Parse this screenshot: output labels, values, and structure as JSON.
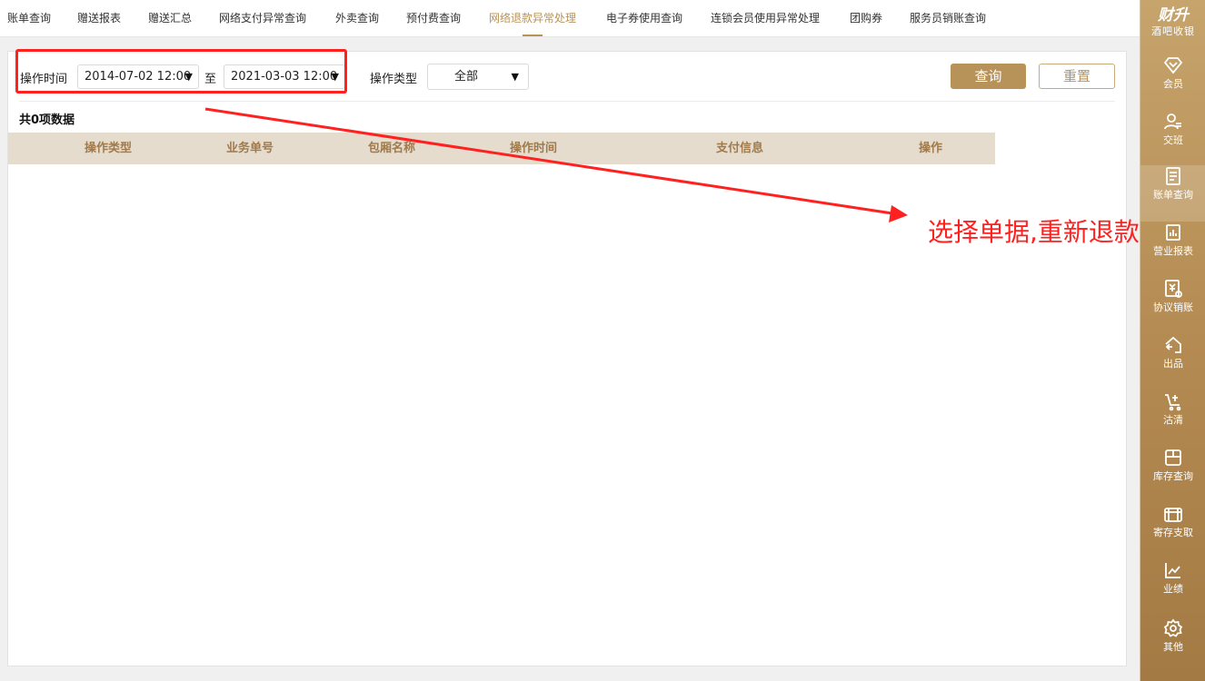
{
  "tabs": [
    {
      "label": "账单查询",
      "active": false
    },
    {
      "label": "赠送报表",
      "active": false
    },
    {
      "label": "赠送汇总",
      "active": false
    },
    {
      "label": "网络支付异常查询",
      "active": false
    },
    {
      "label": "外卖查询",
      "active": false
    },
    {
      "label": "预付费查询",
      "active": false
    },
    {
      "label": "网络退款异常处理",
      "active": true
    },
    {
      "label": "电子券使用查询",
      "active": false
    },
    {
      "label": "连锁会员使用异常处理",
      "active": false
    },
    {
      "label": "团购券",
      "active": false
    },
    {
      "label": "服务员销账查询",
      "active": false
    }
  ],
  "filters": {
    "time_label": "操作时间",
    "start_time": "2014-07-02 12:00",
    "range_sep": "至",
    "end_time": "2021-03-03 12:00",
    "type_label": "操作类型",
    "type_value": "全部",
    "search_label": "查询",
    "reset_label": "重置"
  },
  "result_count": "共0项数据",
  "table": {
    "columns": [
      "操作类型",
      "业务单号",
      "包厢名称",
      "操作时间",
      "支付信息",
      "操作"
    ],
    "rows": []
  },
  "annotation": {
    "text": "选择单据,重新退款",
    "color": "#ff2020"
  },
  "sidebar": {
    "brand_title": "财升",
    "brand_subtitle": "酒吧收银",
    "items": [
      {
        "label": "会员",
        "icon": "diamond-icon",
        "active": false
      },
      {
        "label": "交班",
        "icon": "shift-handover-icon",
        "active": false
      },
      {
        "label": "账单查询",
        "icon": "bill-query-icon",
        "active": true
      },
      {
        "label": "营业报表",
        "icon": "report-icon",
        "active": false
      },
      {
        "label": "协议销账",
        "icon": "agreement-writeoff-icon",
        "active": false
      },
      {
        "label": "出品",
        "icon": "output-icon",
        "active": false
      },
      {
        "label": "沽清",
        "icon": "sold-out-cart-icon",
        "active": false
      },
      {
        "label": "库存查询",
        "icon": "inventory-box-icon",
        "active": false
      },
      {
        "label": "寄存支取",
        "icon": "storage-icon",
        "active": false
      },
      {
        "label": "业绩",
        "icon": "performance-chart-icon",
        "active": false
      },
      {
        "label": "其他",
        "icon": "gear-icon",
        "active": false
      }
    ]
  },
  "colors": {
    "accent": "#b89359",
    "header_bg": "#e6dccd",
    "header_text": "#a07a4a",
    "annotation": "#ff2020"
  }
}
